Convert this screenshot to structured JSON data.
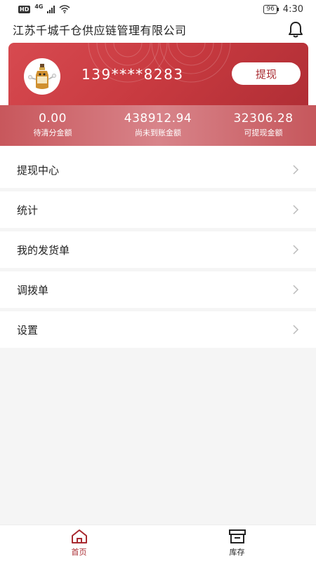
{
  "status_bar": {
    "hd": "HD",
    "network": "4G",
    "battery": "96",
    "time": "4:30"
  },
  "header": {
    "company_name": "江苏千城千仓供应链管理有限公司",
    "bell_icon": "bell-icon"
  },
  "account": {
    "avatar_icon": "bottle-mascot-avatar",
    "phone": "139****8283",
    "withdraw_label": "提现"
  },
  "stats": [
    {
      "value": "0.00",
      "label": "待清分金额"
    },
    {
      "value": "438912.94",
      "label": "尚未到账金额"
    },
    {
      "value": "32306.28",
      "label": "可提现金额"
    }
  ],
  "menu": [
    {
      "label": "提现中心"
    },
    {
      "label": "统计"
    },
    {
      "label": "我的发货单"
    },
    {
      "label": "调拨单"
    },
    {
      "label": "设置"
    }
  ],
  "tabbar": {
    "tabs": [
      {
        "label": "首页",
        "icon": "home-icon",
        "active": true
      },
      {
        "label": "库存",
        "icon": "archive-box-icon",
        "active": false
      }
    ],
    "active_color": "#a82a30",
    "inactive_color": "#222222"
  },
  "colors": {
    "accent": "#c83a40",
    "accent_dark": "#a82a30",
    "background": "#f5f5f5"
  }
}
